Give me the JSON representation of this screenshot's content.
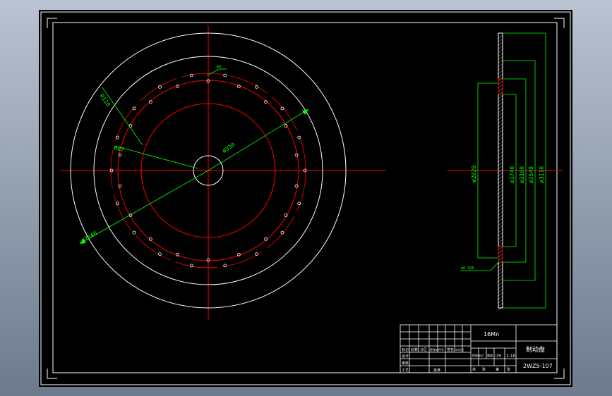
{
  "drawing": {
    "dimensions": {
      "front_r110": "R110",
      "front_r87": "R87",
      "front_d330": "ø330",
      "front_d2546": "ø2546",
      "leader_note": "φ8",
      "side_d2020": "ø2020",
      "side_d1740": "ø1740",
      "side_d2180": "ø2180",
      "side_d2548": "ø2548",
      "side_d3110": "ø3110",
      "side_note": "φ8 均布"
    },
    "title_block": {
      "material": "16Mn",
      "part_name": "制动盘",
      "drawing_number": "2WZ5-107",
      "scale": "1:10",
      "row_headers": [
        "标记",
        "处数",
        "分区",
        "更改文件号",
        "签名",
        "年月日"
      ],
      "row_labels": [
        "设计",
        "审核",
        "工艺"
      ],
      "stage_headers": [
        "阶段标记",
        "重量",
        "比例"
      ],
      "sheet_info": [
        "共",
        "张",
        "第",
        "张"
      ],
      "approve": "批准"
    },
    "colors": {
      "background": "#000000",
      "outline": "#ffffff",
      "center_line": "#ff0000",
      "dimension": "#00ff00",
      "annotation": "#ffff00"
    }
  }
}
